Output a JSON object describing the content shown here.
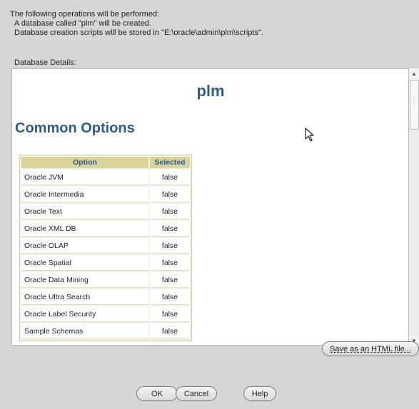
{
  "summary": {
    "heading": "The following operations will be performed:",
    "lines": [
      "A database called \"plm\" will be created.",
      "Database creation scripts will be stored in \"E:\\oracle\\admin\\plm\\scripts\"."
    ],
    "details_label": "Database Details:"
  },
  "report": {
    "db_name": "plm",
    "section_title": "Common Options",
    "columns": [
      "Option",
      "Selected"
    ],
    "rows": [
      {
        "option": "Oracle JVM",
        "selected": "false"
      },
      {
        "option": "Oracle Intermedia",
        "selected": "false"
      },
      {
        "option": "Oracle Text",
        "selected": "false"
      },
      {
        "option": "Oracle XML DB",
        "selected": "false"
      },
      {
        "option": "Oracle OLAP",
        "selected": "false"
      },
      {
        "option": "Oracle Spatial",
        "selected": "false"
      },
      {
        "option": "Oracle Data Mining",
        "selected": "false"
      },
      {
        "option": "Oracle Ultra Search",
        "selected": "false"
      },
      {
        "option": "Oracle Label Security",
        "selected": "false"
      },
      {
        "option": "Sample Schemas",
        "selected": "false"
      }
    ]
  },
  "buttons": {
    "save_html": "Save as an HTML file...",
    "ok": "OK",
    "cancel": "Cancel",
    "help": "Help"
  },
  "icons": {
    "cursor": "mouse-pointer-icon",
    "scroll_up": "scroll-up-arrow-icon",
    "scroll_down": "scroll-down-arrow-icon"
  },
  "colors": {
    "heading_blue": "#2d5c8d",
    "table_header_bg": "#d9d49a",
    "dialog_bg": "#d6d6d6"
  }
}
